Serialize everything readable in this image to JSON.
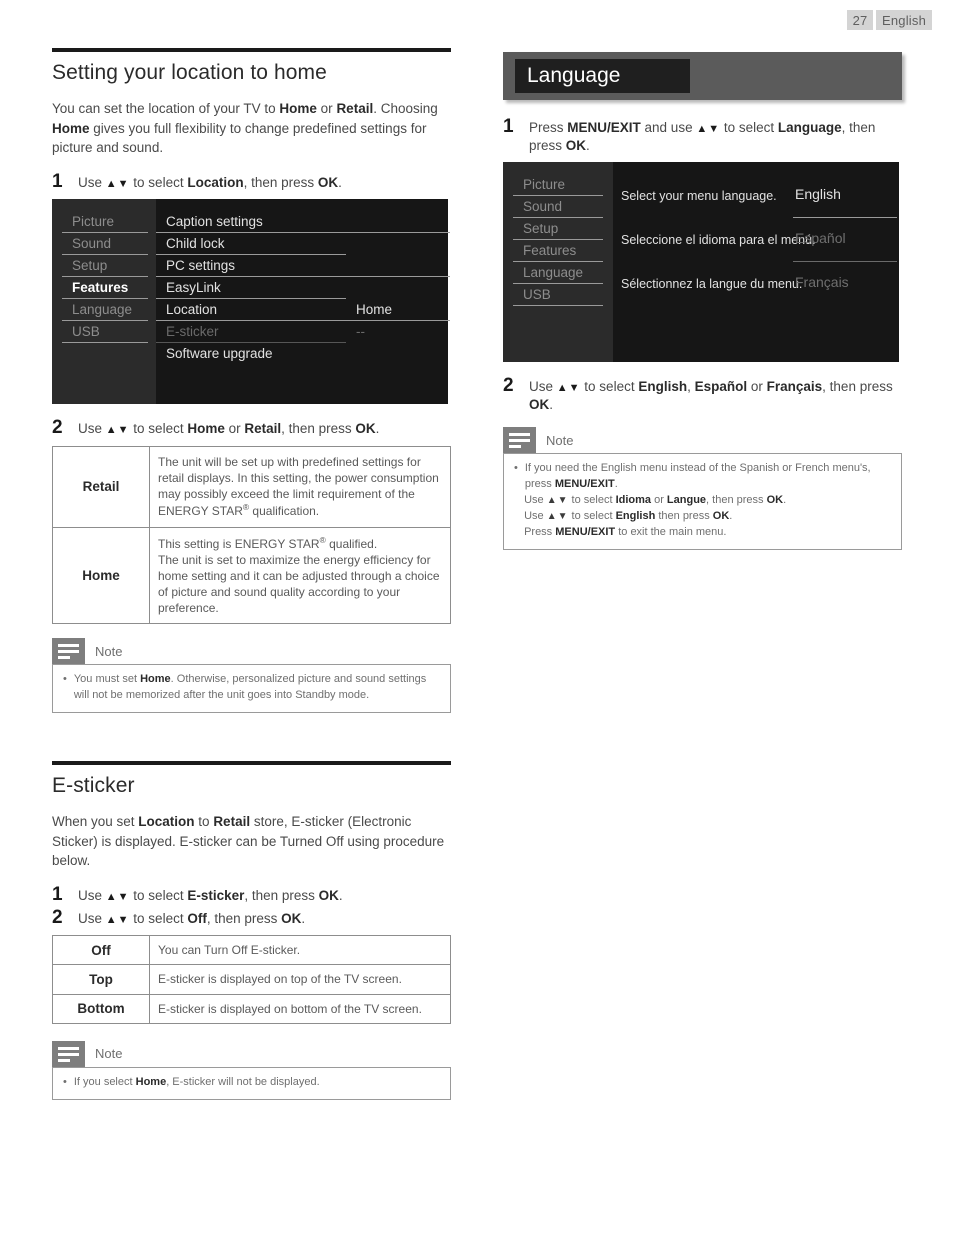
{
  "page_header": {
    "page_number": "27",
    "language": "English"
  },
  "left_column": {
    "section1": {
      "title": "Setting your location to home",
      "intro_parts": [
        {
          "t": "You can set the location of your TV to ",
          "b": false
        },
        {
          "t": "Home",
          "b": true
        },
        {
          "t": " or ",
          "b": false
        },
        {
          "t": "Retail",
          "b": true
        },
        {
          "t": ". Choosing ",
          "b": false
        },
        {
          "t": "Home",
          "b": true
        },
        {
          "t": " gives you full flexibility to change predefined settings for picture and sound.",
          "b": false
        }
      ],
      "step1": {
        "num": "1",
        "parts": [
          {
            "t": "Use ",
            "b": false
          },
          {
            "t": "▲▼",
            "b": false,
            "arrow": true
          },
          {
            "t": " to select ",
            "b": false
          },
          {
            "t": "Location",
            "b": true
          },
          {
            "t": ", then press ",
            "b": false
          },
          {
            "t": "OK",
            "b": true
          },
          {
            "t": ".",
            "b": false
          }
        ]
      },
      "tv_menu": {
        "sidebar": [
          {
            "label": "Picture",
            "selected": false
          },
          {
            "label": "Sound",
            "selected": false
          },
          {
            "label": "Setup",
            "selected": false
          },
          {
            "label": "Features",
            "selected": true
          },
          {
            "label": "Language",
            "selected": false
          },
          {
            "label": "USB",
            "selected": false
          }
        ],
        "items": [
          {
            "label": "Caption settings",
            "value": "",
            "dim": false,
            "line": true,
            "value_line": true,
            "value_blank": true
          },
          {
            "label": "Child lock",
            "value": "",
            "dim": false,
            "line": true,
            "value_line": false,
            "value_blank": true
          },
          {
            "label": "PC settings",
            "value": "",
            "dim": false,
            "line": true,
            "value_line": true,
            "value_blank": true
          },
          {
            "label": "EasyLink",
            "value": "",
            "dim": false,
            "line": true,
            "value_line": false,
            "value_blank": true
          },
          {
            "label": "Location",
            "value": "Home",
            "dim": false,
            "line": true,
            "value_line": true,
            "value_blank": false
          },
          {
            "label": "E-sticker",
            "value": "--",
            "dim": true,
            "line": true,
            "value_line": false,
            "value_blank": false
          },
          {
            "label": "Software upgrade",
            "value": "",
            "dim": false,
            "line": false,
            "value_line": false,
            "value_blank": true
          }
        ]
      },
      "step2": {
        "num": "2",
        "parts": [
          {
            "t": "Use ",
            "b": false
          },
          {
            "t": "▲▼",
            "b": false,
            "arrow": true
          },
          {
            "t": " to select ",
            "b": false
          },
          {
            "t": "Home",
            "b": true
          },
          {
            "t": " or ",
            "b": false
          },
          {
            "t": "Retail",
            "b": true
          },
          {
            "t": ", then press ",
            "b": false
          },
          {
            "t": "OK",
            "b": true
          },
          {
            "t": ".",
            "b": false
          }
        ]
      },
      "table": {
        "rows": [
          {
            "key": "Retail",
            "value": "The unit will be set up with predefined settings for retail displays. In this setting, the power consumption may possibly exceed the limit requirement of the ENERGY STAR® qualification."
          },
          {
            "key": "Home",
            "value": "This setting is ENERGY STAR® qualified.\nThe unit is set to maximize the energy efficiency for home setting and it can be adjusted through a choice of picture and sound quality according to your preference."
          }
        ]
      },
      "note": {
        "label": "Note",
        "items": [
          {
            "parts": [
              {
                "t": "You must set ",
                "b": false
              },
              {
                "t": "Home",
                "b": true
              },
              {
                "t": ". Otherwise, personalized picture and sound settings will not be memorized after the unit goes into Standby mode.",
                "b": false
              }
            ]
          }
        ]
      }
    },
    "section2": {
      "title": "E-sticker",
      "intro_parts": [
        {
          "t": "When you set ",
          "b": false
        },
        {
          "t": "Location",
          "b": true
        },
        {
          "t": " to ",
          "b": false
        },
        {
          "t": "Retail",
          "b": true
        },
        {
          "t": " store, E-sticker (Electronic Sticker) is displayed. E-sticker can be Turned Off using procedure below.",
          "b": false
        }
      ],
      "step1": {
        "num": "1",
        "parts": [
          {
            "t": "Use ",
            "b": false
          },
          {
            "t": "▲▼",
            "b": false,
            "arrow": true
          },
          {
            "t": " to select ",
            "b": false
          },
          {
            "t": "E-sticker",
            "b": true
          },
          {
            "t": ", then press ",
            "b": false
          },
          {
            "t": "OK",
            "b": true
          },
          {
            "t": ".",
            "b": false
          }
        ]
      },
      "step2": {
        "num": "2",
        "parts": [
          {
            "t": "Use ",
            "b": false
          },
          {
            "t": "▲▼",
            "b": false,
            "arrow": true
          },
          {
            "t": " to select ",
            "b": false
          },
          {
            "t": "Off",
            "b": true
          },
          {
            "t": ", then press ",
            "b": false
          },
          {
            "t": "OK",
            "b": true
          },
          {
            "t": ".",
            "b": false
          }
        ]
      },
      "table": {
        "rows": [
          {
            "key": "Off",
            "value": "You can Turn Off E-sticker."
          },
          {
            "key": "Top",
            "value": "E-sticker is displayed on top of the TV screen."
          },
          {
            "key": "Bottom",
            "value": "E-sticker is displayed on bottom of the TV screen."
          }
        ]
      },
      "note": {
        "label": "Note",
        "items": [
          {
            "parts": [
              {
                "t": "If you select ",
                "b": false
              },
              {
                "t": "Home",
                "b": true
              },
              {
                "t": ", E-sticker will not be displayed.",
                "b": false
              }
            ]
          }
        ]
      }
    }
  },
  "right_column": {
    "banner_title": "Language",
    "step1": {
      "num": "1",
      "parts": [
        {
          "t": "Press ",
          "b": false
        },
        {
          "t": "MENU/EXIT",
          "b": true
        },
        {
          "t": " and use ",
          "b": false
        },
        {
          "t": "▲▼",
          "b": false,
          "arrow": true
        },
        {
          "t": " to select ",
          "b": false
        },
        {
          "t": "Language",
          "b": true
        },
        {
          "t": ", then press ",
          "b": false
        },
        {
          "t": "OK",
          "b": true
        },
        {
          "t": ".",
          "b": false
        }
      ]
    },
    "tv_menu": {
      "sidebar": [
        {
          "label": "Picture",
          "selected": false
        },
        {
          "label": "Sound",
          "selected": false
        },
        {
          "label": "Setup",
          "selected": false
        },
        {
          "label": "Features",
          "selected": false
        },
        {
          "label": "Language",
          "selected": true
        },
        {
          "label": "USB",
          "selected": false
        }
      ],
      "rows": [
        {
          "description": "Select your menu language.",
          "value": "English",
          "dim": false
        },
        {
          "description": "Seleccione el idioma para el menú.",
          "value": "Español",
          "dim": true
        },
        {
          "description": "Sélectionnez la langue du menu.",
          "value": "Français",
          "dim": true
        }
      ]
    },
    "step2": {
      "num": "2",
      "parts": [
        {
          "t": "Use ",
          "b": false
        },
        {
          "t": "▲▼",
          "b": false,
          "arrow": true
        },
        {
          "t": " to select ",
          "b": false
        },
        {
          "t": "English",
          "b": true
        },
        {
          "t": ", ",
          "b": false
        },
        {
          "t": "Español",
          "b": true
        },
        {
          "t": " or ",
          "b": false
        },
        {
          "t": "Français",
          "b": true
        },
        {
          "t": ", then press ",
          "b": false
        },
        {
          "t": "OK",
          "b": true
        },
        {
          "t": ".",
          "b": false
        }
      ]
    },
    "note": {
      "label": "Note",
      "items": [
        {
          "parts": [
            {
              "t": "If you need the English menu instead of the Spanish or French menu's, press ",
              "b": false
            },
            {
              "t": "MENU/EXIT",
              "b": true
            },
            {
              "t": ".",
              "b": false
            }
          ]
        },
        {
          "nobullet": true,
          "parts": [
            {
              "t": "Use ",
              "b": false
            },
            {
              "t": "▲▼",
              "b": false,
              "arrow": true
            },
            {
              "t": " to select ",
              "b": false
            },
            {
              "t": "Idioma",
              "b": true
            },
            {
              "t": " or ",
              "b": false
            },
            {
              "t": "Langue",
              "b": true
            },
            {
              "t": ", then press ",
              "b": false
            },
            {
              "t": "OK",
              "b": true
            },
            {
              "t": ".",
              "b": false
            }
          ]
        },
        {
          "nobullet": true,
          "parts": [
            {
              "t": "Use ",
              "b": false
            },
            {
              "t": "▲▼",
              "b": false,
              "arrow": true
            },
            {
              "t": " to select ",
              "b": false
            },
            {
              "t": "English",
              "b": true
            },
            {
              "t": " then press ",
              "b": false
            },
            {
              "t": "OK",
              "b": true
            },
            {
              "t": ".",
              "b": false
            }
          ]
        },
        {
          "nobullet": true,
          "parts": [
            {
              "t": "Press ",
              "b": false
            },
            {
              "t": "MENU/EXIT",
              "b": true
            },
            {
              "t": " to exit the main menu.",
              "b": false
            }
          ]
        }
      ]
    }
  },
  "colors": {
    "rule": "#1a1a1a",
    "tv_bg": "#161616",
    "tv_side_bg": "#2b2b2b",
    "banner_bg": "#5b5b5b",
    "banner_box": "#1f1f1f",
    "note_icon": "#7e7e7e",
    "header_chip": "#d4d4d4"
  }
}
